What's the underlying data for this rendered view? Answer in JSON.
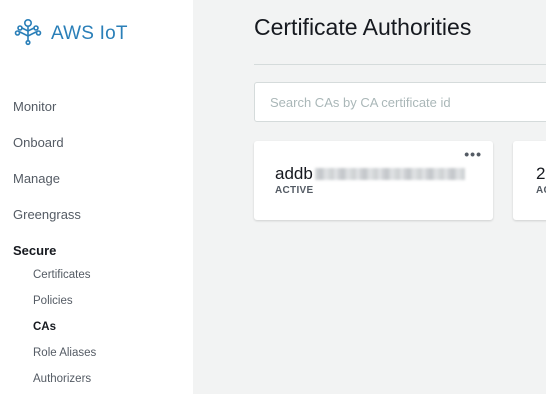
{
  "brand": {
    "name": "AWS IoT",
    "color": "#2a7fb8"
  },
  "sidebar": {
    "items": [
      {
        "label": "Monitor"
      },
      {
        "label": "Onboard"
      },
      {
        "label": "Manage"
      },
      {
        "label": "Greengrass"
      },
      {
        "label": "Secure",
        "active": true
      }
    ],
    "sub_items": [
      {
        "label": "Certificates"
      },
      {
        "label": "Policies"
      },
      {
        "label": "CAs",
        "active": true
      },
      {
        "label": "Role Aliases"
      },
      {
        "label": "Authorizers"
      }
    ]
  },
  "main": {
    "title": "Certificate Authorities",
    "search": {
      "placeholder": "Search CAs by CA certificate id",
      "value": ""
    },
    "cards": [
      {
        "ca_id_visible": "addb",
        "status": "ACTIVE",
        "menu_icon": "ellipsis-icon"
      },
      {
        "ca_id_visible": "2",
        "status": "AC"
      }
    ]
  }
}
